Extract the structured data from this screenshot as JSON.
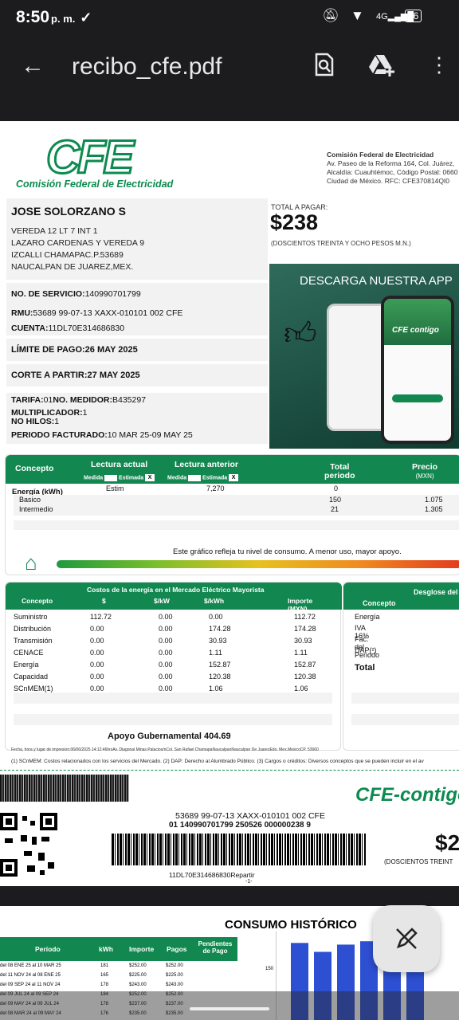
{
  "status": {
    "time": "8:50",
    "ampm": "p. m.",
    "battery": "26"
  },
  "appbar": {
    "title": "recibo_cfe.pdf"
  },
  "company": {
    "logo": "CFE",
    "logo_sub": "Comisión Federal de Electricidad",
    "name": "Comisión Federal de Electricidad",
    "addr1": "Av. Paseo de la Reforma 164, Col. Juárez,",
    "addr2": "Alcaldía: Cuauhtémoc, Código Postal: 0660",
    "addr3": "Ciudad de México. RFC: CFE370814QI0"
  },
  "customer": {
    "name": "JOSE SOLORZANO S",
    "addr1": "VEREDA 12 LT 7 INT 1",
    "addr2": "LAZARO CARDENAS Y VEREDA 9",
    "addr3": "IZCALLI CHAMAPAC.P.53689",
    "addr4": "NAUCALPAN DE JUAREZ,MEX."
  },
  "payment": {
    "label": "TOTAL A PAGAR:",
    "amount": "$238",
    "words": "(DOSCIENTOS TREINTA Y OCHO PESOS  M.N.)"
  },
  "promo": {
    "title": "DESCARGA NUESTRA APP",
    "app": "CFE contigo"
  },
  "service": {
    "no_label": "NO. DE SERVICIO:",
    "no": "140990701799",
    "rmu_label": "RMU:",
    "rmu": "53689 99-07-13 XAXX-010101 002 CFE",
    "cuenta_label": "CUENTA:",
    "cuenta": "11DL70E314686830",
    "limite": "LÍMITE DE PAGO:26 MAY 2025",
    "corte": "CORTE A PARTIR:27 MAY 2025",
    "tarifa_label": "TARIFA:",
    "tarifa": "01",
    "medidor_label": "NO. MEDIDOR:",
    "medidor": "B435297",
    "mult_label": "MULTIPLICADOR:",
    "mult": "1",
    "hilos_label": "NO HILOS:",
    "hilos": "1",
    "periodo_label": "PERIODO FACTURADO:",
    "periodo": "10 MAR 25-09 MAY 25"
  },
  "consumo": {
    "h_concepto": "Concepto",
    "h_actual": "Lectura actual",
    "h_anterior": "Lectura anterior",
    "h_medida": "Medida",
    "h_estimada": "Estimada",
    "h_total": "Total",
    "h_periodo": "periodo",
    "h_precio": "Precio",
    "h_mxn": "(MXN)",
    "energia": "Energía (kWh)",
    "estim": "Estim",
    "anterior": "7,270",
    "total0": "0",
    "basico": "Basico",
    "basico_kwh": "150",
    "basico_p": "1.075",
    "intermedio": "Intermedio",
    "inter_kwh": "21",
    "inter_p": "1.305",
    "grafico": "Este gráfico refleja tu nivel de consumo. A menor uso, mayor apoyo."
  },
  "mercado": {
    "title": "Costos de la energía en el Mercado Eléctrico Mayorista",
    "cols": [
      "Concepto",
      "$",
      "$/kW",
      "$/kWh",
      "Importe (MXN)"
    ],
    "rows": [
      [
        "Suministro",
        "112.72",
        "0.00",
        "0.00",
        "112.72"
      ],
      [
        "Distribución",
        "0.00",
        "0.00",
        "174.28",
        "174.28"
      ],
      [
        "Transmisión",
        "0.00",
        "0.00",
        "30.93",
        "30.93"
      ],
      [
        "CENACE",
        "0.00",
        "0.00",
        "1.11",
        "1.11"
      ],
      [
        "Energía",
        "0.00",
        "0.00",
        "152.87",
        "152.87"
      ],
      [
        "Capacidad",
        "0.00",
        "0.00",
        "120.38",
        "120.38"
      ],
      [
        "SCnMEM(1)",
        "0.00",
        "0.00",
        "1.06",
        "1.06"
      ]
    ],
    "apoyo": "Apoyo Gubernamental 404.69"
  },
  "desglose": {
    "title": "Desglose del i",
    "h_concepto": "Concepto",
    "items": [
      "Energía",
      "IVA 16%",
      "Fac. del Periodo",
      "DAP(²)"
    ],
    "total": "Total"
  },
  "foot": {
    "fecha": "Fecha, hora y lugar de impresion:06/06/2025 14:12:46hrsAv. Diagonal Minas Palacios/nCol. San Rafael ChamapaNaucalpanNaucalpan De JuarezEdo. Mex.MexicoCP. 53660",
    "notes": "(1) SCnMEM: Costos relacionados con los servicios del Mercado. (2) DAP: Derecho al Alumbrado Público. (3) Cargos o créditos: Diversos conceptos que se pueden incluir en el av"
  },
  "barcode": {
    "brand": "CFE-contigo",
    "line1": "53689 99-07-13 XAXX-010101 002 CFE",
    "line2": "01 140990701799 250526 000000238 9",
    "amount": "$2",
    "words": "(DOSCIENTOS TREINT",
    "cuenta": "11DL70E314686830Repartir",
    "page": "-1-"
  },
  "historico": {
    "title": "CONSUMO HISTÓRICO",
    "cols": [
      "Período",
      "kWh",
      "Importe",
      "Pagos",
      "Pendientes de Pago"
    ],
    "rows": [
      [
        "del 08 ENE 25 al 10 MAR 25",
        "181",
        "$252.00",
        "$252.00"
      ],
      [
        "del 11 NOV 24 al 08 ENE 25",
        "165",
        "$225.00",
        "$225.00"
      ],
      [
        "del 09 SEP 24 al 11 NOV 24",
        "178",
        "$243.00",
        "$243.00"
      ],
      [
        "del 09 JUL 24 al 09 SEP 24",
        "184",
        "$252.00",
        "$252.00"
      ],
      [
        "del 09 MAY 24 al 09 JUL 24",
        "178",
        "$237.00",
        "$237.00"
      ],
      [
        "del 08 MAR 24 al 09 MAY 24",
        "176",
        "$235.00",
        "$235.00"
      ]
    ],
    "ytick": "150"
  },
  "chart_data": {
    "type": "bar",
    "title": "CONSUMO HISTÓRICO",
    "ytick": "150",
    "values": [
      181,
      165,
      178,
      184,
      178,
      176
    ]
  }
}
